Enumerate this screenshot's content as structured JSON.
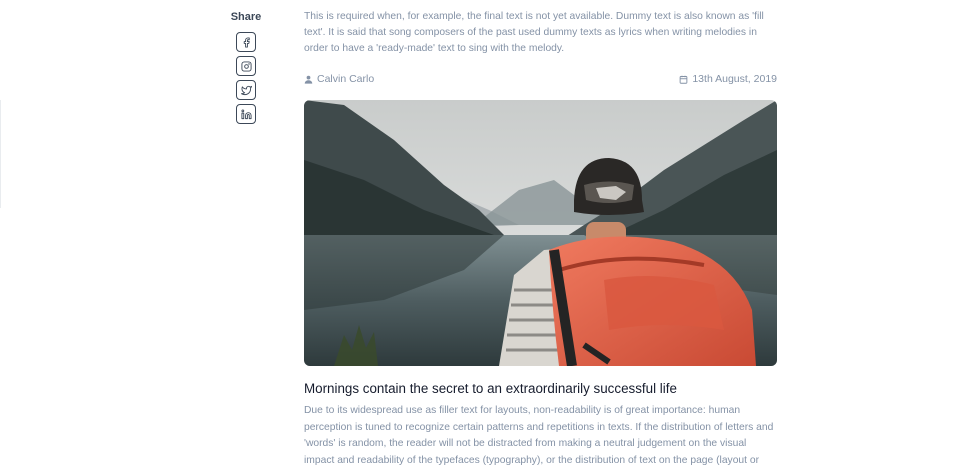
{
  "share": {
    "title": "Share",
    "icons": [
      "facebook-icon",
      "instagram-icon",
      "twitter-icon",
      "linkedin-icon"
    ]
  },
  "article": {
    "intro": "This is required when, for example, the final text is not yet available. Dummy text is also known as 'fill text'. It is said that song composers of the past used dummy texts as lyrics when writing melodies in order to have a 'ready-made' text to sing with the melody.",
    "author": "Calvin Carlo",
    "date": "13th August, 2019",
    "image_alt": "Hiker with an orange backpack looking over a mountain lake",
    "title": "Mornings contain the secret to an extraordinarily successful life",
    "body": "Due to its widespread use as filler text for layouts, non-readability is of great importance: human perception is tuned to recognize certain patterns and repetitions in texts. If the distribution of letters and 'words' is random, the reader will not be distracted from making a neutral judgement on the visual impact and readability of the typefaces (typography), or the distribution of text on the page (layout or type area)."
  },
  "colors": {
    "heading": "#161c2d",
    "text": "#3c4858",
    "muted": "#8492a6",
    "backpack": "#e8664b"
  }
}
